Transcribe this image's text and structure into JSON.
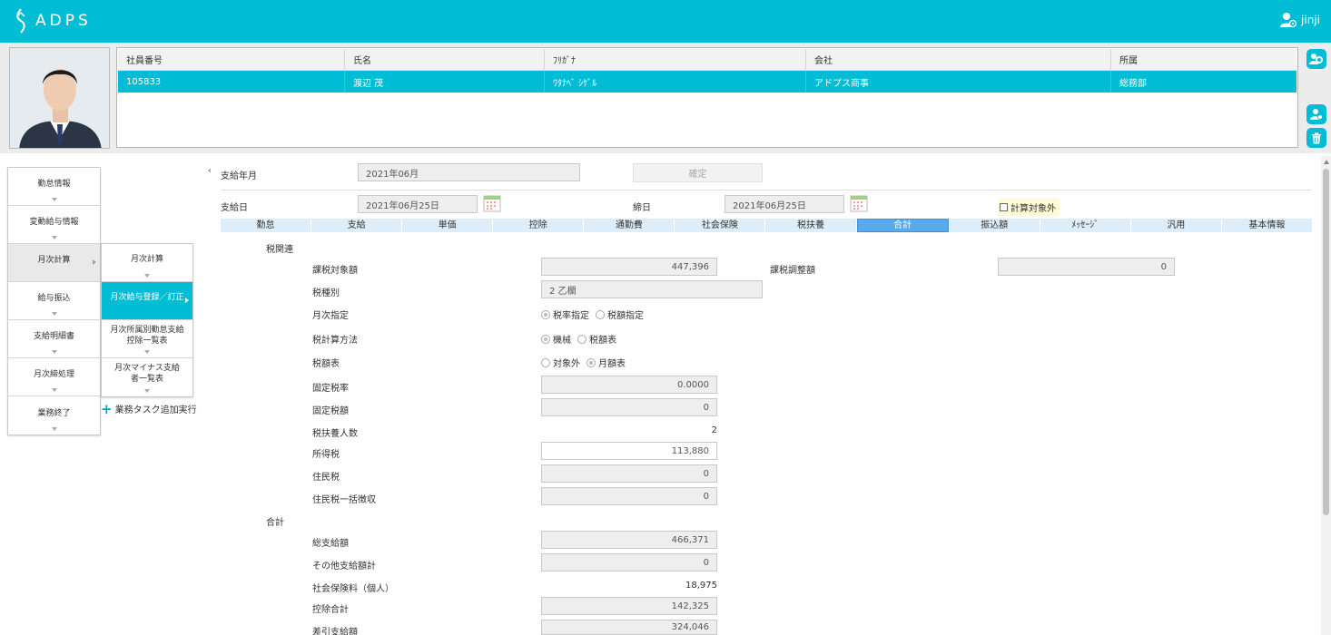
{
  "app": {
    "logo_text": "ADPS",
    "user_name": "jinji"
  },
  "employee": {
    "headers": [
      "社員番号",
      "氏名",
      "ﾌﾘｶﾞﾅ",
      "会社",
      "所属"
    ],
    "row": [
      "105833",
      "渡辺 茂",
      "ﾜﾀﾅﾍﾞ ｼｹﾞﾙ",
      "アドプス商事",
      "総務部"
    ]
  },
  "menu": {
    "main": [
      {
        "label": "勤怠情報"
      },
      {
        "label": "変動給与情報"
      },
      {
        "label": "月次計算"
      },
      {
        "label": "給与振込"
      },
      {
        "label": "支給明細書"
      },
      {
        "label": "月次締処理"
      },
      {
        "label": "業務終了"
      }
    ],
    "sub": [
      {
        "label": "月次計算"
      },
      {
        "label": "月次給与登録／訂正"
      },
      {
        "label": "月次所属別勤怠支給控除一覧表"
      },
      {
        "label": "月次マイナス支給者一覧表"
      }
    ],
    "add_task": "業務タスク追加実行",
    "collapse": "‹"
  },
  "form": {
    "pay_month_label": "支給年月",
    "pay_month_value": "2021年06月",
    "confirm_label": "確定",
    "pay_date_label": "支給日",
    "pay_date_value": "2021年06月25日",
    "close_date_label": "締日",
    "close_date_value": "2021年06月25日",
    "exclude_label": "計算対象外"
  },
  "tabs": [
    "勤怠",
    "支給",
    "単価",
    "控除",
    "通勤費",
    "社会保険",
    "税扶養",
    "合計",
    "振込額",
    "ﾒｯｾｰｼﾞ",
    "汎用",
    "基本情報"
  ],
  "active_tab": "合計",
  "tax": {
    "section_label": "税関連",
    "taxable_label": "課税対象額",
    "taxable_value": "447,396",
    "adjust_label": "課税調整額",
    "adjust_value": "0",
    "type_label": "税種別",
    "type_value": "2 乙欄",
    "monthly_label": "月次指定",
    "monthly_opt1": "税率指定",
    "monthly_opt2": "税額指定",
    "method_label": "税計算方法",
    "method_opt1": "機械",
    "method_opt2": "税額表",
    "table_label": "税額表",
    "table_opt1": "対象外",
    "table_opt2": "月額表",
    "fixed_rate_label": "固定税率",
    "fixed_rate_value": "0.0000",
    "fixed_amount_label": "固定税額",
    "fixed_amount_value": "0",
    "dependents_label": "税扶養人数",
    "dependents_value": "2",
    "income_tax_label": "所得税",
    "income_tax_value": "113,880",
    "resident_tax_label": "住民税",
    "resident_tax_value": "0",
    "resident_lump_label": "住民税一括徴収",
    "resident_lump_value": "0"
  },
  "totals": {
    "section_label": "合計",
    "gross_label": "総支給額",
    "gross_value": "466,371",
    "other_label": "その他支給額計",
    "other_value": "0",
    "social_label": "社会保険料（個人）",
    "social_value": "18,975",
    "deduct_label": "控除合計",
    "deduct_value": "142,325",
    "net_label": "差引支給額",
    "net_value": "324,046"
  }
}
